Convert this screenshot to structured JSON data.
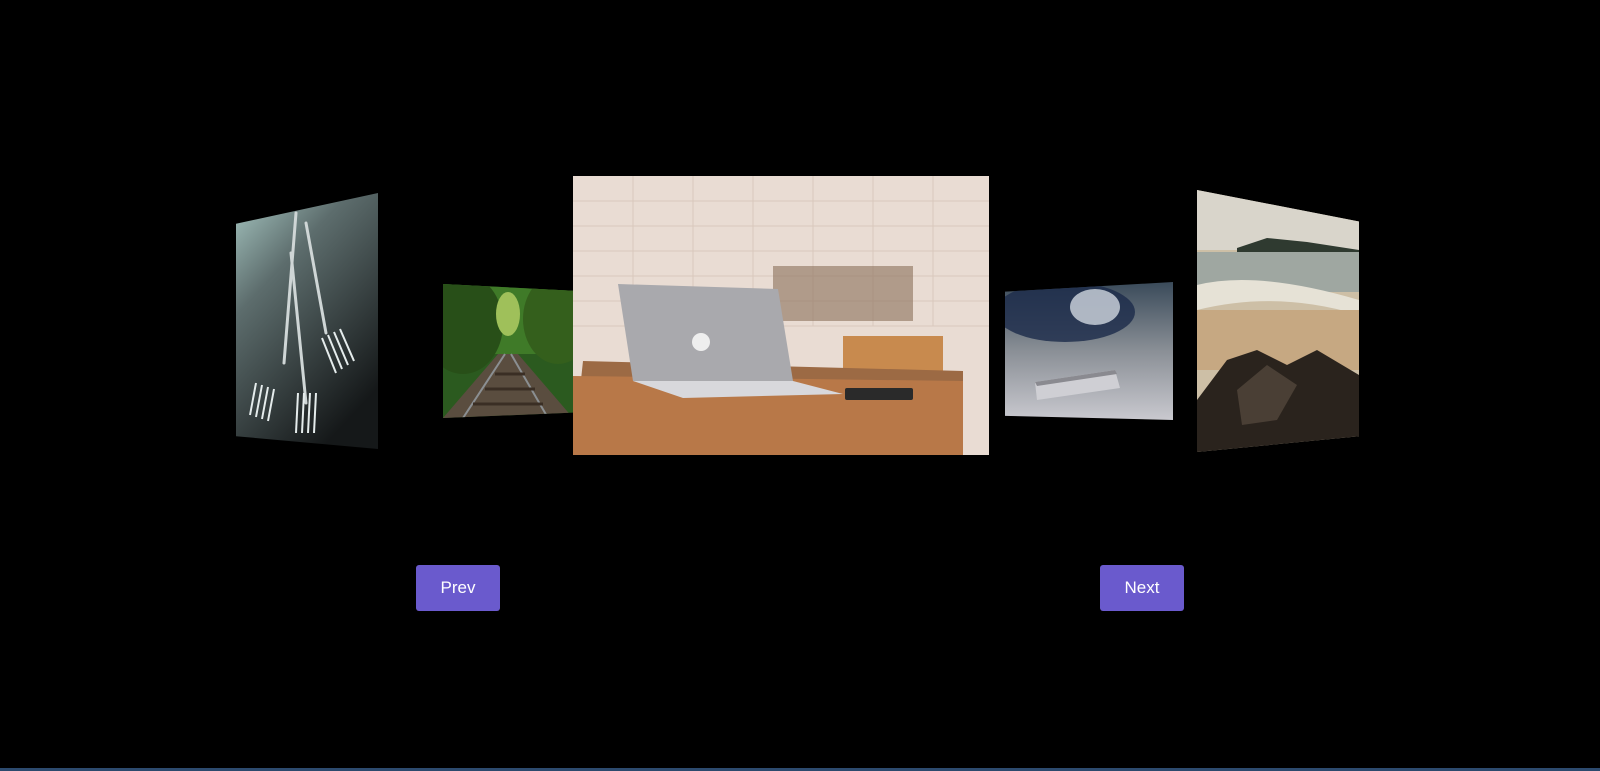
{
  "carousel": {
    "slides": [
      {
        "subject": "forks",
        "position": "far-left"
      },
      {
        "subject": "railway-tracks",
        "position": "left"
      },
      {
        "subject": "laptop-on-desk",
        "position": "center"
      },
      {
        "subject": "smartphone",
        "position": "right"
      },
      {
        "subject": "beach-rocks",
        "position": "far-right"
      }
    ]
  },
  "controls": {
    "prev_label": "Prev",
    "next_label": "Next",
    "button_color": "#6a5acd"
  },
  "colors": {
    "background": "#000000"
  }
}
